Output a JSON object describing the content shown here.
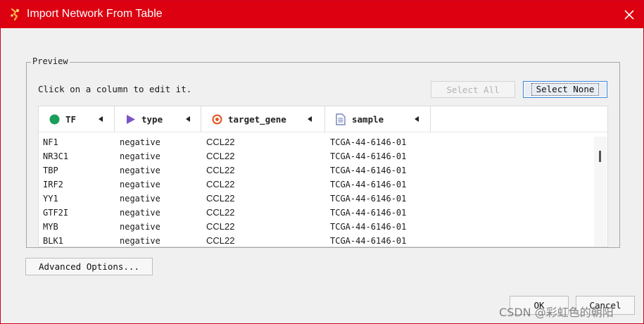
{
  "window": {
    "title": "Import Network From Table",
    "title_bar_color": "#dc0010"
  },
  "preview": {
    "group_label": "Preview",
    "hint": "Click on a column to edit it.",
    "select_all_label": "Select All",
    "select_none_label": "Select None"
  },
  "table": {
    "columns": [
      {
        "label": "TF",
        "icon": "source-node-icon",
        "icon_color": "#1a9e5c"
      },
      {
        "label": "type",
        "icon": "interaction-icon",
        "icon_color": "#7b54c4"
      },
      {
        "label": "target_gene",
        "icon": "target-node-icon",
        "icon_color": "#e0531f"
      },
      {
        "label": "sample",
        "icon": "attribute-document-icon",
        "icon_color": "#5b6fb0"
      }
    ],
    "rows": [
      [
        "NF1",
        "negative",
        "CCL22",
        "TCGA-44-6146-01"
      ],
      [
        "NR3C1",
        "negative",
        "CCL22",
        "TCGA-44-6146-01"
      ],
      [
        "TBP",
        "negative",
        "CCL22",
        "TCGA-44-6146-01"
      ],
      [
        "IRF2",
        "negative",
        "CCL22",
        "TCGA-44-6146-01"
      ],
      [
        "YY1",
        "negative",
        "CCL22",
        "TCGA-44-6146-01"
      ],
      [
        "GTF2I",
        "negative",
        "CCL22",
        "TCGA-44-6146-01"
      ],
      [
        "MYB",
        "negative",
        "CCL22",
        "TCGA-44-6146-01"
      ],
      [
        "BLK1",
        "negative",
        "CCL22",
        "TCGA-44-6146-01"
      ]
    ]
  },
  "buttons": {
    "advanced_options": "Advanced Options...",
    "ok": "OK",
    "cancel": "Cancel"
  },
  "watermark": "CSDN @彩虹色的朝阳"
}
